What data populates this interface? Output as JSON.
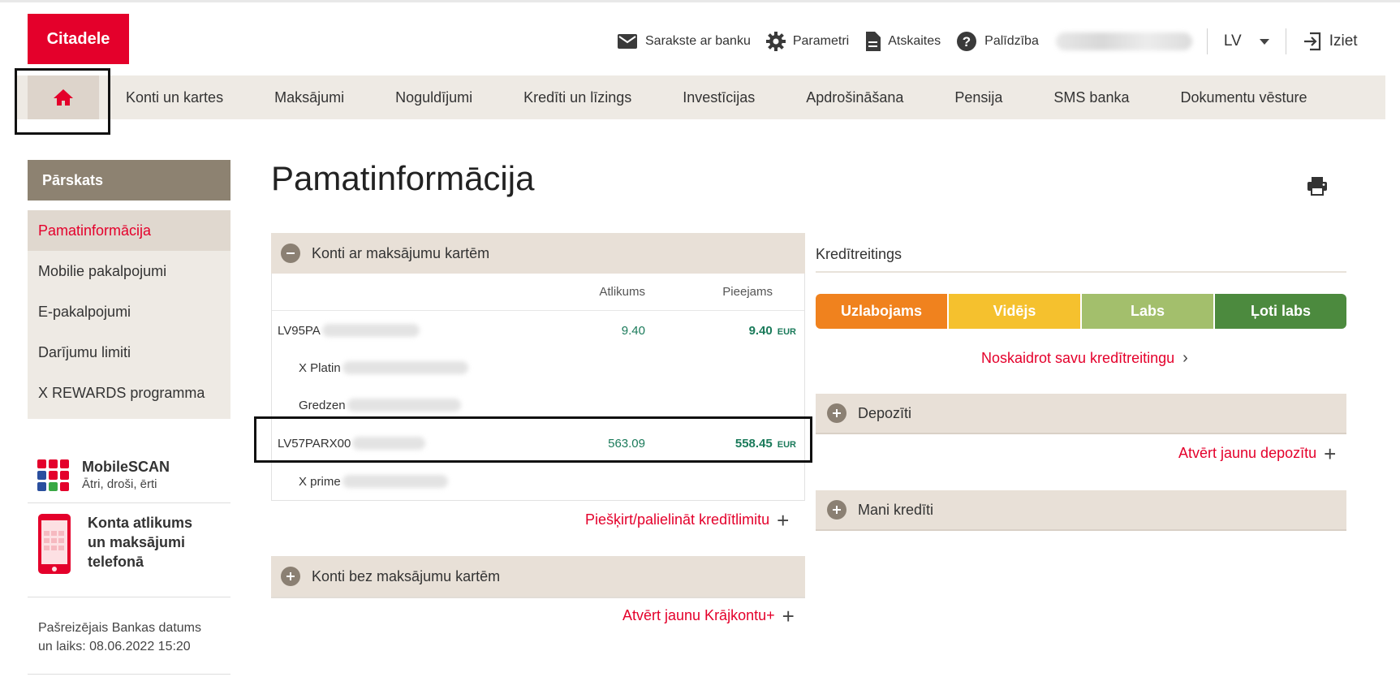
{
  "brand": {
    "logo_text": "Citadele",
    "accent": "#e4002b"
  },
  "header": {
    "links": [
      {
        "label": "Sarakste ar banku",
        "icon": "mail-icon"
      },
      {
        "label": "Parametri",
        "icon": "gear-icon"
      },
      {
        "label": "Atskaites",
        "icon": "document-icon"
      },
      {
        "label": "Palīdzība",
        "icon": "help-icon"
      }
    ],
    "language": "LV",
    "logout_label": "Iziet"
  },
  "nav": {
    "home_icon": "home-icon",
    "items": [
      "Konti un kartes",
      "Maksājumi",
      "Noguldījumi",
      "Kredīti un līzings",
      "Investīcijas",
      "Apdrošināšana",
      "Pensija",
      "SMS banka",
      "Dokumentu vēsture"
    ]
  },
  "sidebar": {
    "heading": "Pārskats",
    "items": [
      "Pamatinformācija",
      "Mobilie pakalpojumi",
      "E-pakalpojumi",
      "Darījumu limiti",
      "X REWARDS programma"
    ],
    "mobilescan": {
      "title": "MobileSCAN",
      "subtitle": "Ātri, droši, ērti"
    },
    "phone_promo": {
      "title_line1": "Konta atlikums",
      "title_line2": "un maksājumi",
      "title_line3": "telefonā"
    },
    "bank_date_line1": "Pašreizējais Bankas datums",
    "bank_date_line2": "un laiks: 08.06.2022 15:20"
  },
  "main": {
    "title": "Pamatinformācija",
    "cards_panel": {
      "title": "Konti ar maksājumu kartēm",
      "col_balance": "Atlikums",
      "col_available": "Pieejams",
      "rows": [
        {
          "name": "LV95PA",
          "balance": "9.40",
          "available": "9.40",
          "currency": "EUR"
        },
        {
          "card": "X Platin"
        },
        {
          "card": "Gredzen"
        },
        {
          "name": "LV57PARX00",
          "balance": "563.09",
          "available": "558.45",
          "currency": "EUR"
        },
        {
          "card": "X prime"
        }
      ],
      "credit_limit_link": "Piešķirt/palielināt kredītlimitu"
    },
    "nocards_panel": {
      "title": "Konti bez maksājumu kartēm",
      "open_link": "Atvērt jaunu Krājkontu+"
    }
  },
  "right": {
    "credit_rating": {
      "title": "Kredītreitings",
      "segments": [
        {
          "label": "Uzlabojams",
          "color": "#f0821e"
        },
        {
          "label": "Vidējs",
          "color": "#f5c12e"
        },
        {
          "label": "Labs",
          "color": "#a3bf6c"
        },
        {
          "label": "Ļoti labs",
          "color": "#4c8a3e"
        }
      ],
      "link": "Noskaidrot savu kredītreitingu"
    },
    "deposits": {
      "title": "Depozīti",
      "open_link": "Atvērt jaunu depozītu"
    },
    "loans": {
      "title": "Mani kredīti"
    }
  }
}
